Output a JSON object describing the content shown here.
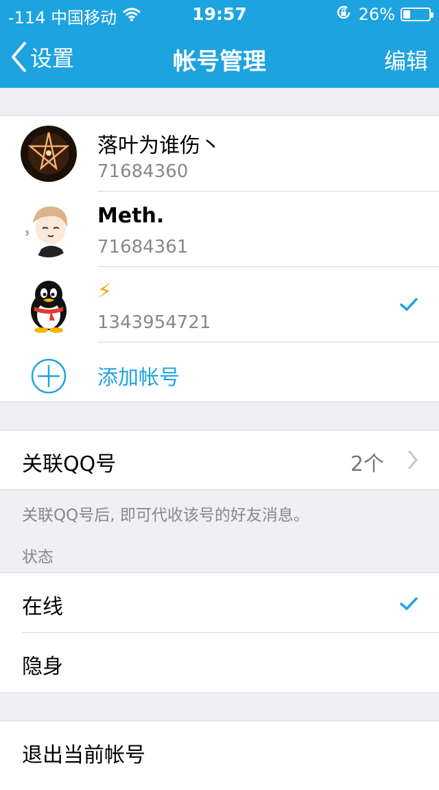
{
  "status_bar": {
    "carrier": "-114 中国移动",
    "time": "19:57",
    "battery": "26%",
    "battery_level": 0.26
  },
  "nav": {
    "back_label": "设置",
    "title": "帐号管理",
    "edit_label": "编辑"
  },
  "accounts": [
    {
      "name": "落叶为谁伤丶",
      "number": "71684360",
      "selected": false
    },
    {
      "name": "Meth.",
      "number": "71684361",
      "selected": false
    },
    {
      "name": "⚡",
      "number": "1343954721",
      "selected": true
    }
  ],
  "add_account_label": "添加帐号",
  "linked": {
    "label": "关联QQ号",
    "count": "2个",
    "note": "关联QQ号后, 即可代收该号的好友消息。"
  },
  "status_section": {
    "header": "状态",
    "options": [
      {
        "label": "在线",
        "selected": true
      },
      {
        "label": "隐身",
        "selected": false
      }
    ]
  },
  "logout_label": "退出当前帐号",
  "colors": {
    "accent": "#1da3e0",
    "background": "#efeff4"
  }
}
